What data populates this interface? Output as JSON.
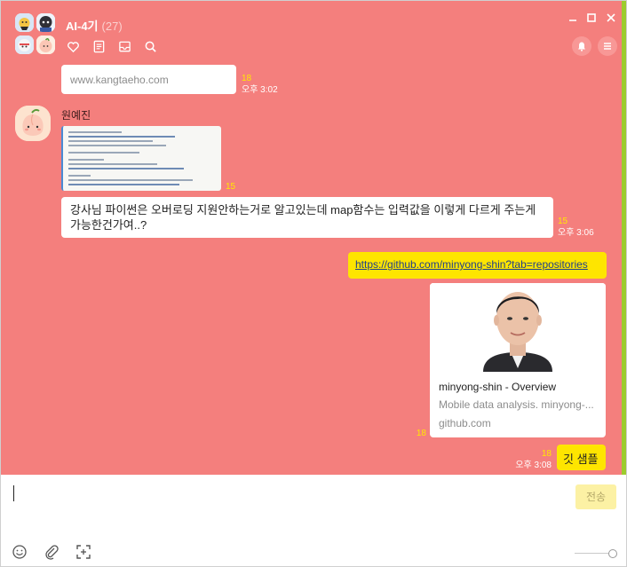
{
  "colors": {
    "background": "#f47f7d",
    "accent_bar": "#9ccc2e",
    "my_bubble": "#fee500",
    "unread": "#ffe800",
    "link": "#1f3f8c"
  },
  "header": {
    "title": "AI-4기",
    "count": "(27)",
    "icons": [
      "heart-icon",
      "notes-icon",
      "inbox-icon",
      "search-icon"
    ],
    "window_controls": [
      "minimize-icon",
      "maximize-icon",
      "close-icon"
    ],
    "right_buttons": [
      "bell-icon",
      "menu-icon"
    ]
  },
  "messages": {
    "first": {
      "text": "www.kangtaeho.com",
      "unread": "18",
      "time": "오후 3:02"
    },
    "sender_name": "원예진",
    "image_message": {
      "unread": "15"
    },
    "question": {
      "text": "강사님 파이썬은 오버로딩 지원안하는거로 알고있는데 map함수는 입력값을 이렇게 다르게 주는게 가능한건가여..?",
      "unread": "15",
      "time": "오후 3:06"
    },
    "link": {
      "text": "https://github.com/minyong-shin?tab=repositories"
    },
    "preview": {
      "title": "minyong-shin - Overview",
      "description": "Mobile data analysis. minyong-...",
      "domain": "github.com",
      "unread": "18"
    },
    "last": {
      "text": "깃 샘플",
      "unread": "18",
      "time": "오후 3:08"
    }
  },
  "input": {
    "send_label": "전송",
    "value": "",
    "tools": [
      "emoji-icon",
      "attach-icon",
      "capture-icon"
    ]
  }
}
